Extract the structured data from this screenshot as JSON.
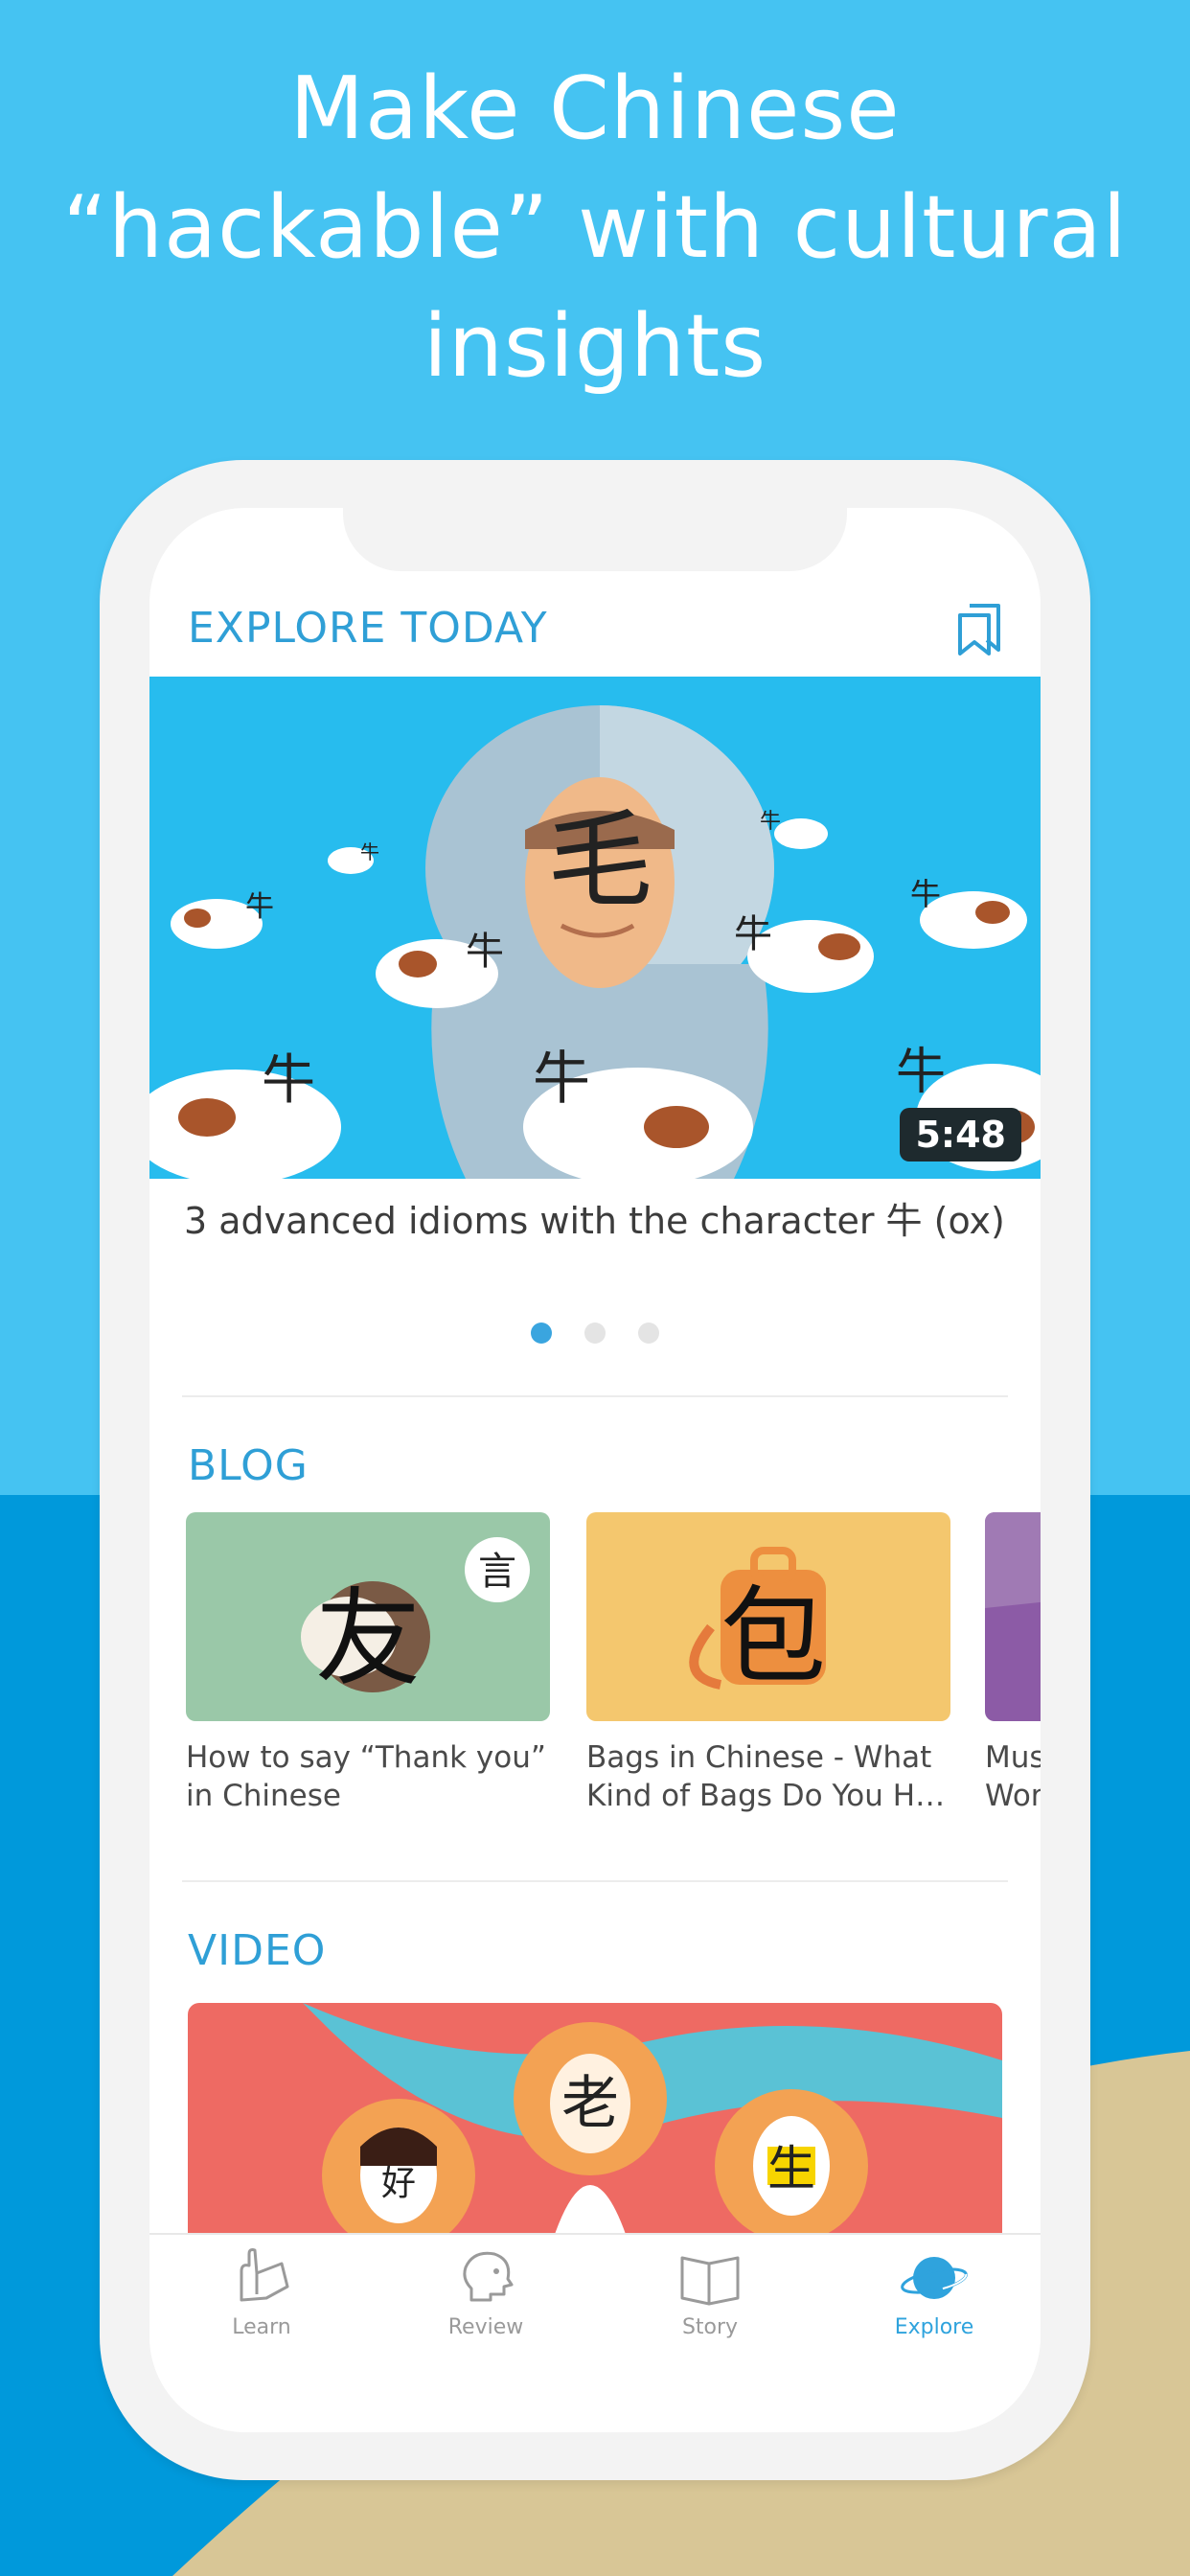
{
  "headline": {
    "line1": "Make Chinese",
    "line2": "“hackable” with cultural",
    "line3": "insights"
  },
  "explore": {
    "title": "EXPLORE TODAY",
    "hero": {
      "duration": "5:48",
      "caption": "3 advanced idioms with the character 牛 (ox)",
      "main_glyph": "毛",
      "ox_glyph": "牛"
    },
    "pager": {
      "count": 3,
      "active_index": 0
    }
  },
  "blog": {
    "title": "BLOG",
    "cards": [
      {
        "title": "How to say “Thank you” in Chinese",
        "glyph": "友",
        "bubble_glyph": "言",
        "color": "#9ac8a8"
      },
      {
        "title": "Bags in Chinese - What Kind of Bags Do You H…",
        "glyph": "包",
        "color": "#f4c76e"
      },
      {
        "title": "Mus… Wor…",
        "color": "#8c5ba6"
      }
    ]
  },
  "video": {
    "title": "VIDEO",
    "glyphs": [
      "好",
      "老",
      "生"
    ]
  },
  "tabbar": {
    "tabs": [
      {
        "label": "Learn",
        "icon": "hand-icon"
      },
      {
        "label": "Review",
        "icon": "head-icon"
      },
      {
        "label": "Story",
        "icon": "book-icon"
      },
      {
        "label": "Explore",
        "icon": "planet-icon",
        "active": true
      }
    ]
  },
  "colors": {
    "sky": "#45c3f2",
    "sea": "#0099db",
    "sand": "#d8c696",
    "accent": "#2f9fd6"
  }
}
